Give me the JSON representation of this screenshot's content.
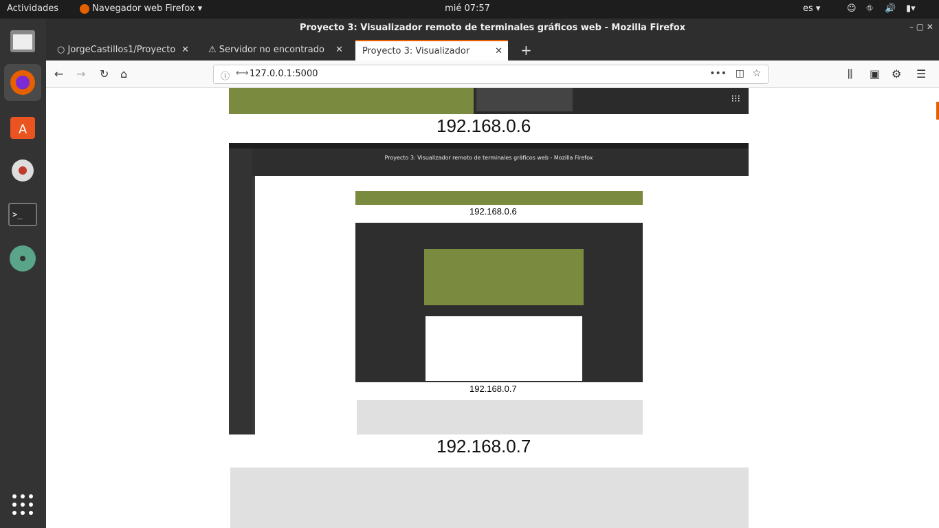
{
  "topbar": {
    "activities": "Actividades",
    "app_menu": "Navegador web Firefox ▾",
    "clock": "mié 07:57",
    "lang": "es ▾"
  },
  "window": {
    "title": "Proyecto 3: Visualizador remoto de terminales gráficos web - Mozilla Firefox"
  },
  "tabs": [
    {
      "label": "JorgeCastillos1/Proyecto"
    },
    {
      "label": "Servidor no encontrado"
    },
    {
      "label": "Proyecto 3: Visualizador"
    }
  ],
  "url": {
    "text": "127.0.0.1:5000"
  },
  "content": {
    "ip_top": "192.168.0.6",
    "ip_bottom": "192.168.0.7",
    "nested_title": "Proyecto 3: Visualizador remoto de terminales gráficos web - Mozilla Firefox",
    "nested_ip_a": "192.168.0.6",
    "nested_ip_b": "192.168.0.7"
  },
  "colors": {
    "firefox_accent": "#e66000",
    "grass": "#7a8a3e"
  },
  "icons": [
    "firefox-icon",
    "software-icon",
    "settings-icon",
    "terminal-icon",
    "disk-icon",
    "app-grid-icon"
  ]
}
